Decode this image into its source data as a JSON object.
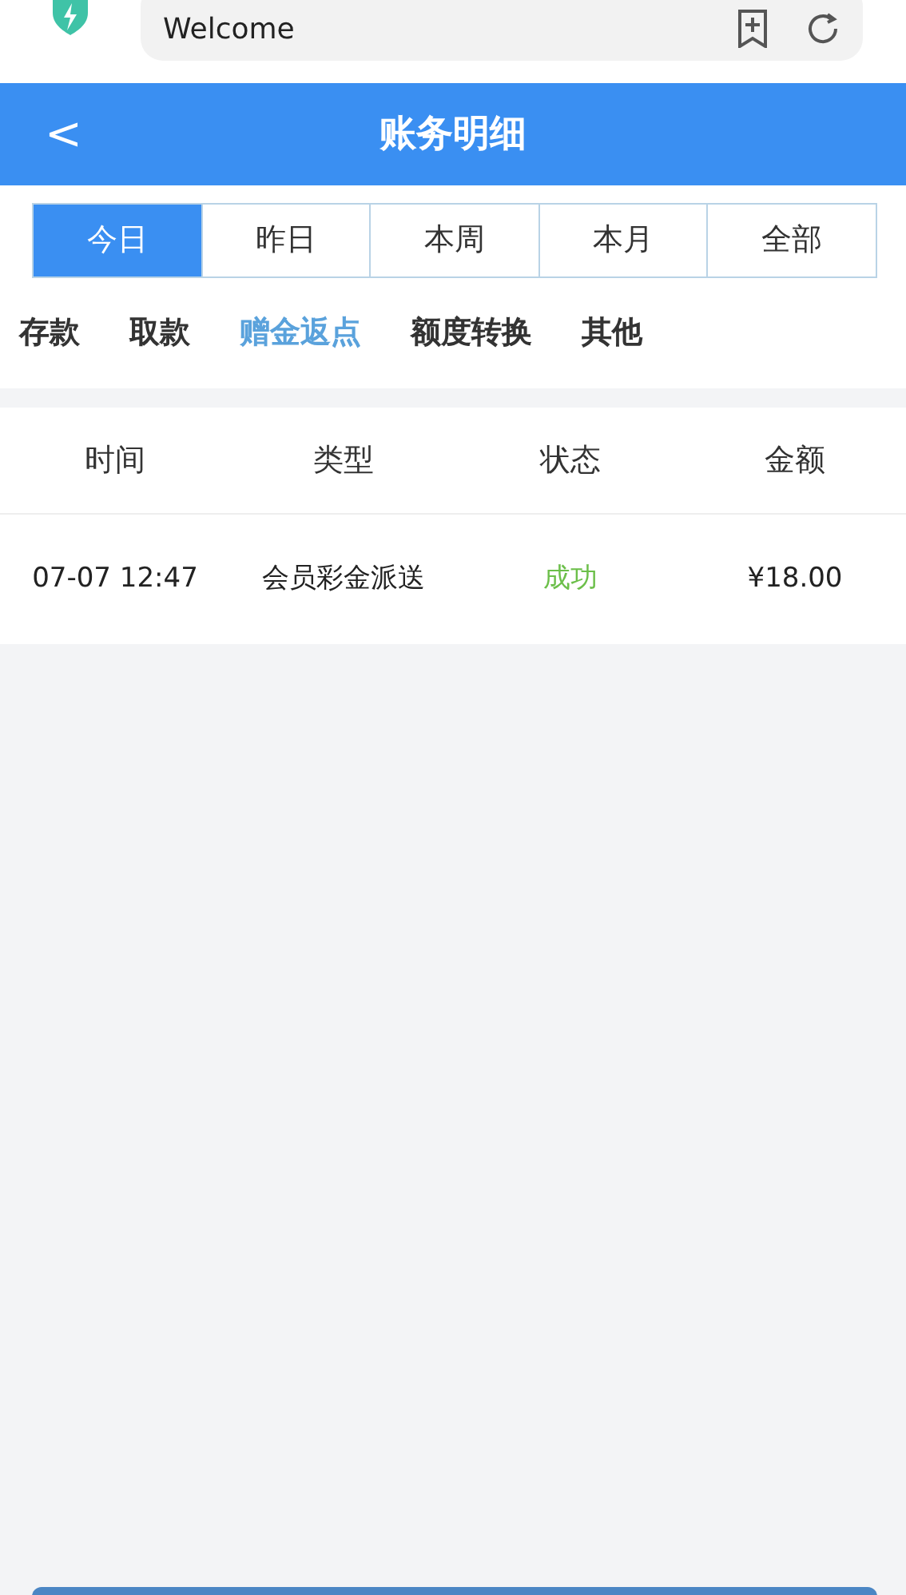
{
  "browser": {
    "address_text": "Welcome"
  },
  "header": {
    "back": "<",
    "title": "账务明细"
  },
  "period_tabs": [
    {
      "label": "今日",
      "selected": true
    },
    {
      "label": "昨日",
      "selected": false
    },
    {
      "label": "本周",
      "selected": false
    },
    {
      "label": "本月",
      "selected": false
    },
    {
      "label": "全部",
      "selected": false
    }
  ],
  "category_tabs": [
    {
      "label": "存款",
      "selected": false
    },
    {
      "label": "取款",
      "selected": false
    },
    {
      "label": "赠金返点",
      "selected": true
    },
    {
      "label": "额度转换",
      "selected": false
    },
    {
      "label": "其他",
      "selected": false
    }
  ],
  "table": {
    "columns": [
      "时间",
      "类型",
      "状态",
      "金额"
    ],
    "rows": [
      {
        "time": "07-07 12:47",
        "type": "会员彩金派送",
        "status": "成功",
        "color": "#6cbf4a",
        "amount": "¥18.00"
      }
    ]
  }
}
